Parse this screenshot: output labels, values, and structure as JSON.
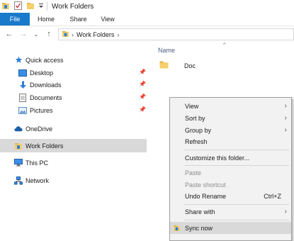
{
  "window": {
    "title": "Work Folders"
  },
  "ribbon": {
    "tabs": [
      "File",
      "Home",
      "Share",
      "View"
    ]
  },
  "address": {
    "crumbs": [
      "Work Folders"
    ]
  },
  "sidebar": {
    "items": [
      {
        "label": "Quick access",
        "icon": "star-icon",
        "pinned": false
      },
      {
        "label": "Desktop",
        "icon": "desktop-icon",
        "pinned": true
      },
      {
        "label": "Downloads",
        "icon": "download-icon",
        "pinned": true
      },
      {
        "label": "Documents",
        "icon": "documents-icon",
        "pinned": true
      },
      {
        "label": "Pictures",
        "icon": "pictures-icon",
        "pinned": true
      },
      {
        "label": "OneDrive",
        "icon": "cloud-icon",
        "pinned": false
      },
      {
        "label": "Work Folders",
        "icon": "work-folders-icon",
        "pinned": false,
        "selected": true
      },
      {
        "label": "This PC",
        "icon": "computer-icon",
        "pinned": false
      },
      {
        "label": "Network",
        "icon": "network-icon",
        "pinned": false
      }
    ]
  },
  "content": {
    "column_header": "Name",
    "files": [
      {
        "name": "Doc",
        "icon": "folder-icon"
      }
    ]
  },
  "context_menu": {
    "items": [
      {
        "label": "View",
        "submenu": true
      },
      {
        "label": "Sort by",
        "submenu": true
      },
      {
        "label": "Group by",
        "submenu": true
      },
      {
        "label": "Refresh"
      },
      {
        "label": "Customize this folder..."
      },
      {
        "label": "Paste",
        "disabled": true
      },
      {
        "label": "Paste shortcut",
        "disabled": true
      },
      {
        "label": "Undo Rename",
        "shortcut": "Ctrl+Z"
      },
      {
        "label": "Share with",
        "submenu": true
      },
      {
        "label": "Sync now",
        "icon": "work-folders-icon",
        "highlighted": true
      }
    ]
  },
  "colors": {
    "accent": "#1979ca",
    "selection": "#d9d9d9",
    "menu_bg": "#f2f2f2",
    "folder": "#f5cf6b"
  }
}
